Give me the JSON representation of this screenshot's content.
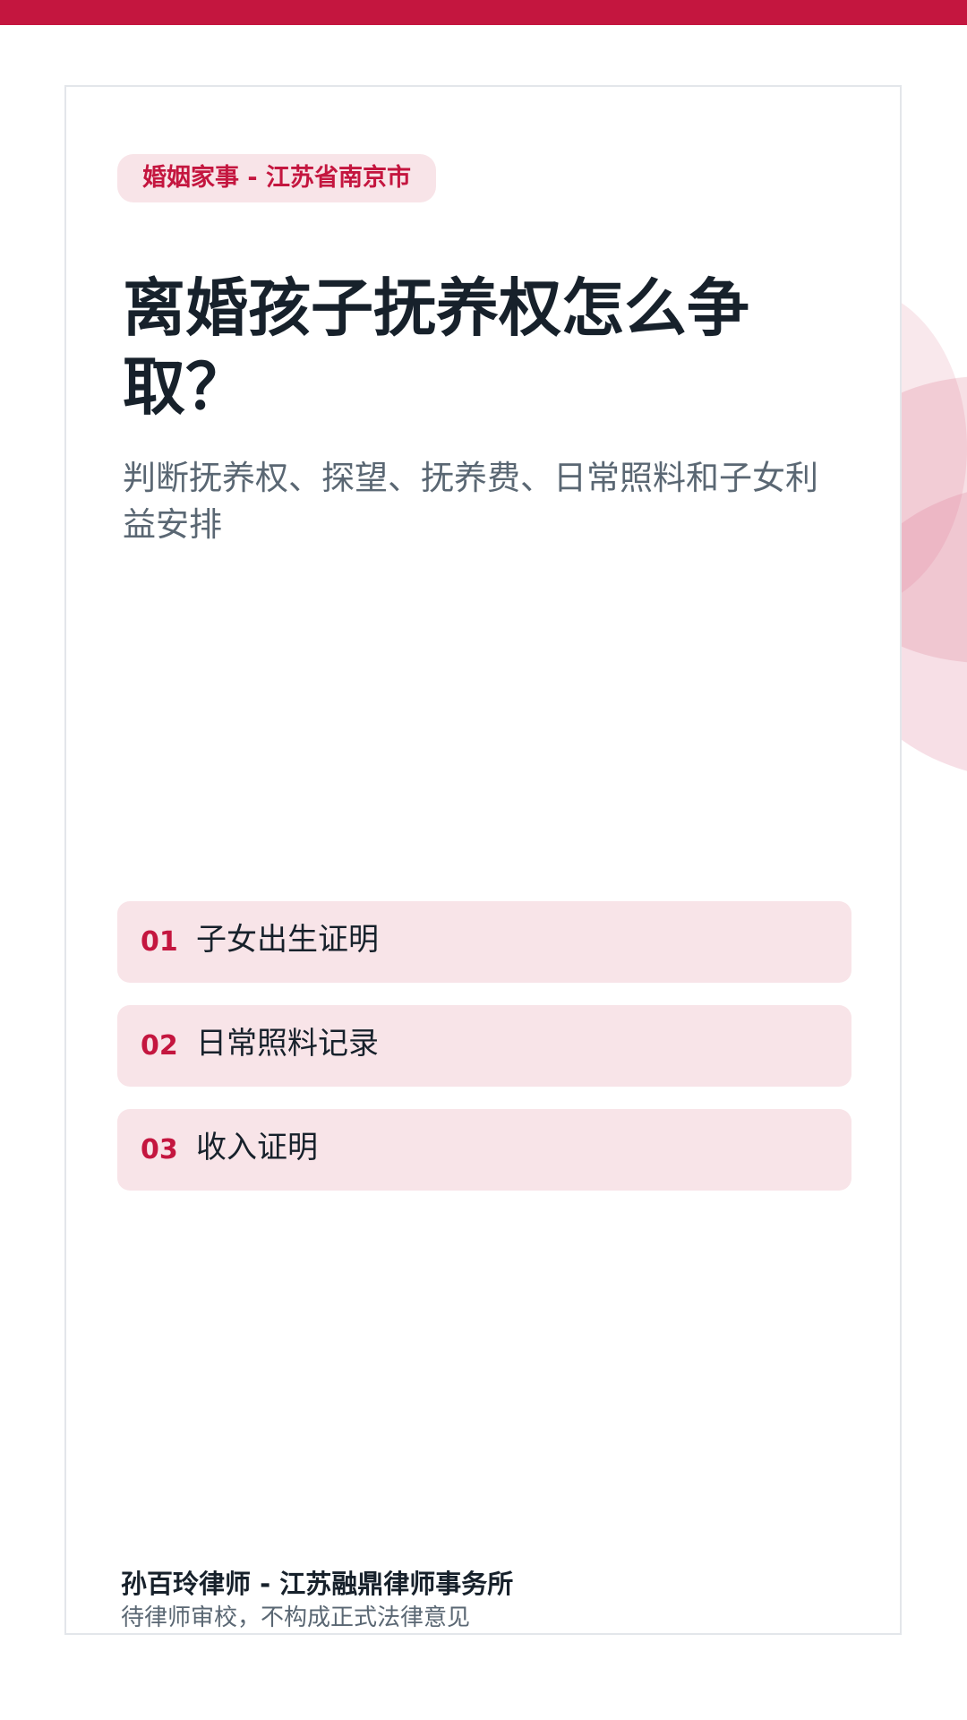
{
  "header": {
    "tag": "婚姻家事 - 江苏省南京市"
  },
  "main": {
    "title": "离婚孩子抚养权怎么争取？",
    "subtitle": "判断抚养权、探望、抚养费、日常照料和子女利益安排"
  },
  "checklist": [
    {
      "number": "01",
      "label": "子女出生证明"
    },
    {
      "number": "02",
      "label": "日常照料记录"
    },
    {
      "number": "03",
      "label": "收入证明"
    }
  ],
  "footer": {
    "author": "孙百玲律师 - 江苏融鼎律师事务所",
    "note": "待律师审校，不构成正式法律意见"
  },
  "colors": {
    "accent": "#c4163f",
    "tag_bg": "#f8e4e8",
    "title": "#17212b",
    "muted": "#5a6773"
  }
}
